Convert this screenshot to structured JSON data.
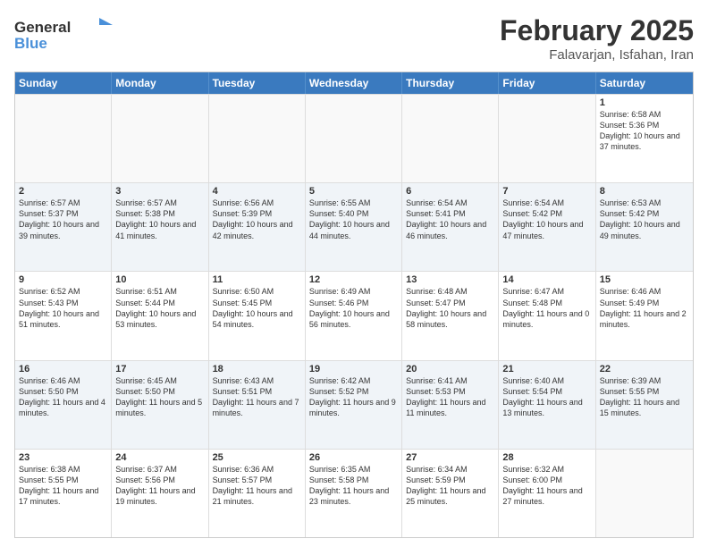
{
  "header": {
    "logo": {
      "text_general": "General",
      "text_blue": "Blue"
    },
    "month": "February 2025",
    "location": "Falavarjan, Isfahan, Iran"
  },
  "weekdays": [
    "Sunday",
    "Monday",
    "Tuesday",
    "Wednesday",
    "Thursday",
    "Friday",
    "Saturday"
  ],
  "weeks": [
    [
      {
        "day": "",
        "info": "",
        "empty": true
      },
      {
        "day": "",
        "info": "",
        "empty": true
      },
      {
        "day": "",
        "info": "",
        "empty": true
      },
      {
        "day": "",
        "info": "",
        "empty": true
      },
      {
        "day": "",
        "info": "",
        "empty": true
      },
      {
        "day": "",
        "info": "",
        "empty": true
      },
      {
        "day": "1",
        "info": "Sunrise: 6:58 AM\nSunset: 5:36 PM\nDaylight: 10 hours and 37 minutes.",
        "empty": false
      }
    ],
    [
      {
        "day": "2",
        "info": "Sunrise: 6:57 AM\nSunset: 5:37 PM\nDaylight: 10 hours and 39 minutes.",
        "empty": false
      },
      {
        "day": "3",
        "info": "Sunrise: 6:57 AM\nSunset: 5:38 PM\nDaylight: 10 hours and 41 minutes.",
        "empty": false
      },
      {
        "day": "4",
        "info": "Sunrise: 6:56 AM\nSunset: 5:39 PM\nDaylight: 10 hours and 42 minutes.",
        "empty": false
      },
      {
        "day": "5",
        "info": "Sunrise: 6:55 AM\nSunset: 5:40 PM\nDaylight: 10 hours and 44 minutes.",
        "empty": false
      },
      {
        "day": "6",
        "info": "Sunrise: 6:54 AM\nSunset: 5:41 PM\nDaylight: 10 hours and 46 minutes.",
        "empty": false
      },
      {
        "day": "7",
        "info": "Sunrise: 6:54 AM\nSunset: 5:42 PM\nDaylight: 10 hours and 47 minutes.",
        "empty": false
      },
      {
        "day": "8",
        "info": "Sunrise: 6:53 AM\nSunset: 5:42 PM\nDaylight: 10 hours and 49 minutes.",
        "empty": false
      }
    ],
    [
      {
        "day": "9",
        "info": "Sunrise: 6:52 AM\nSunset: 5:43 PM\nDaylight: 10 hours and 51 minutes.",
        "empty": false
      },
      {
        "day": "10",
        "info": "Sunrise: 6:51 AM\nSunset: 5:44 PM\nDaylight: 10 hours and 53 minutes.",
        "empty": false
      },
      {
        "day": "11",
        "info": "Sunrise: 6:50 AM\nSunset: 5:45 PM\nDaylight: 10 hours and 54 minutes.",
        "empty": false
      },
      {
        "day": "12",
        "info": "Sunrise: 6:49 AM\nSunset: 5:46 PM\nDaylight: 10 hours and 56 minutes.",
        "empty": false
      },
      {
        "day": "13",
        "info": "Sunrise: 6:48 AM\nSunset: 5:47 PM\nDaylight: 10 hours and 58 minutes.",
        "empty": false
      },
      {
        "day": "14",
        "info": "Sunrise: 6:47 AM\nSunset: 5:48 PM\nDaylight: 11 hours and 0 minutes.",
        "empty": false
      },
      {
        "day": "15",
        "info": "Sunrise: 6:46 AM\nSunset: 5:49 PM\nDaylight: 11 hours and 2 minutes.",
        "empty": false
      }
    ],
    [
      {
        "day": "16",
        "info": "Sunrise: 6:46 AM\nSunset: 5:50 PM\nDaylight: 11 hours and 4 minutes.",
        "empty": false
      },
      {
        "day": "17",
        "info": "Sunrise: 6:45 AM\nSunset: 5:50 PM\nDaylight: 11 hours and 5 minutes.",
        "empty": false
      },
      {
        "day": "18",
        "info": "Sunrise: 6:43 AM\nSunset: 5:51 PM\nDaylight: 11 hours and 7 minutes.",
        "empty": false
      },
      {
        "day": "19",
        "info": "Sunrise: 6:42 AM\nSunset: 5:52 PM\nDaylight: 11 hours and 9 minutes.",
        "empty": false
      },
      {
        "day": "20",
        "info": "Sunrise: 6:41 AM\nSunset: 5:53 PM\nDaylight: 11 hours and 11 minutes.",
        "empty": false
      },
      {
        "day": "21",
        "info": "Sunrise: 6:40 AM\nSunset: 5:54 PM\nDaylight: 11 hours and 13 minutes.",
        "empty": false
      },
      {
        "day": "22",
        "info": "Sunrise: 6:39 AM\nSunset: 5:55 PM\nDaylight: 11 hours and 15 minutes.",
        "empty": false
      }
    ],
    [
      {
        "day": "23",
        "info": "Sunrise: 6:38 AM\nSunset: 5:55 PM\nDaylight: 11 hours and 17 minutes.",
        "empty": false
      },
      {
        "day": "24",
        "info": "Sunrise: 6:37 AM\nSunset: 5:56 PM\nDaylight: 11 hours and 19 minutes.",
        "empty": false
      },
      {
        "day": "25",
        "info": "Sunrise: 6:36 AM\nSunset: 5:57 PM\nDaylight: 11 hours and 21 minutes.",
        "empty": false
      },
      {
        "day": "26",
        "info": "Sunrise: 6:35 AM\nSunset: 5:58 PM\nDaylight: 11 hours and 23 minutes.",
        "empty": false
      },
      {
        "day": "27",
        "info": "Sunrise: 6:34 AM\nSunset: 5:59 PM\nDaylight: 11 hours and 25 minutes.",
        "empty": false
      },
      {
        "day": "28",
        "info": "Sunrise: 6:32 AM\nSunset: 6:00 PM\nDaylight: 11 hours and 27 minutes.",
        "empty": false
      },
      {
        "day": "",
        "info": "",
        "empty": true
      }
    ]
  ]
}
